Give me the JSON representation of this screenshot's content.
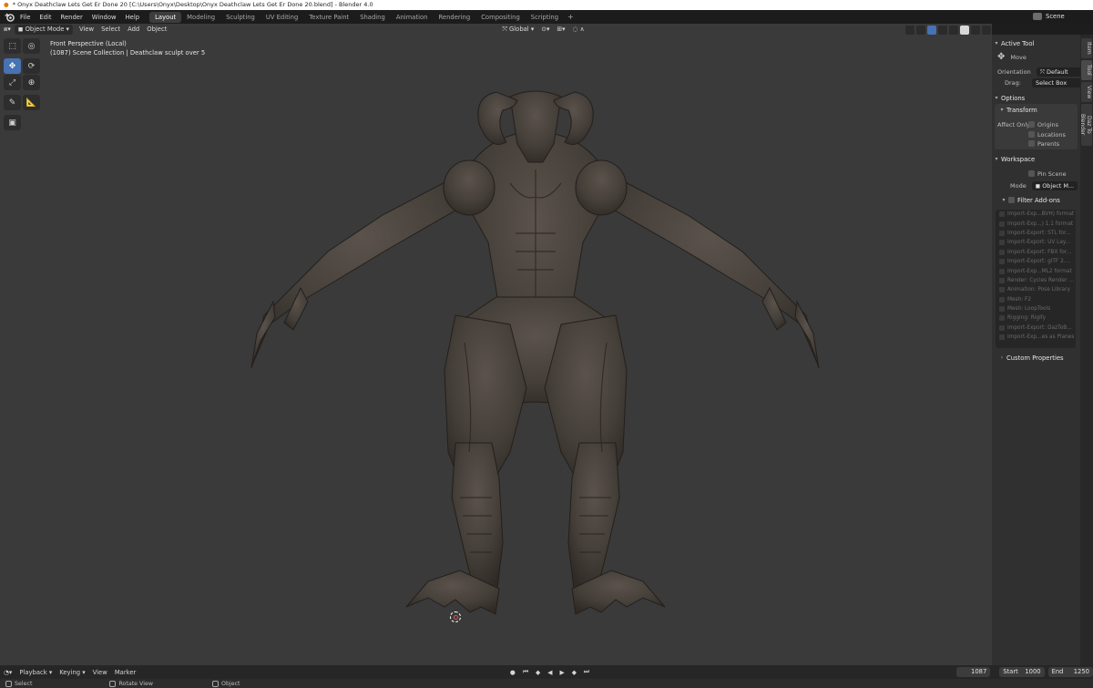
{
  "window": {
    "title": "* Onyx Deathclaw Lets Get Er Done 20 [C:\\Users\\Onyx\\Desktop\\Onyx Deathclaw Lets Get Er Done 20.blend] - Blender 4.0"
  },
  "menu": {
    "items": [
      "File",
      "Edit",
      "Render",
      "Window",
      "Help"
    ]
  },
  "workspaces": {
    "tabs": [
      "Layout",
      "Modeling",
      "Sculpting",
      "UV Editing",
      "Texture Paint",
      "Shading",
      "Animation",
      "Rendering",
      "Compositing",
      "Scripting"
    ],
    "active": "Layout"
  },
  "scene": {
    "name": "Scene"
  },
  "viewport": {
    "mode": "Object Mode",
    "menus": [
      "View",
      "Select",
      "Add",
      "Object"
    ],
    "transform_orientation": "Global",
    "perspective_label": "Front Perspective (Local)",
    "collection_label": "(1087) Scene Collection | Deathclaw sculpt over 5"
  },
  "sidebar": {
    "tabs": [
      "Item",
      "Tool",
      "View",
      "Daz To Blender"
    ],
    "active_tool": {
      "header": "Active Tool",
      "tool_name": "Move",
      "orientation_label": "Orientation",
      "orientation_value": "Default",
      "drag_label": "Drag:",
      "drag_value": "Select Box"
    },
    "options": {
      "header": "Options",
      "transform_header": "Transform",
      "affect_only_label": "Affect Only",
      "affect_only": [
        "Origins",
        "Locations",
        "Parents"
      ]
    },
    "workspace": {
      "header": "Workspace",
      "pin_scene": "Pin Scene",
      "mode_label": "Mode",
      "mode_value": "Object M...",
      "filter_addons": "Filter Add-ons",
      "addons": [
        "Import-Exp...BVH) format",
        "Import-Exp...) 1.1 format",
        "Import-Export: STL for...",
        "Import-Export: UV Lay...",
        "Import-Export: FBX for...",
        "Import-Export: glTF 2....",
        "Import-Exp...ML2 format",
        "Render: Cycles Render ...",
        "Animation: Pose Library",
        "Mesh: F2",
        "Mesh: LoopTools",
        "Rigging: Rigify",
        "Import-Export: DazToB...",
        "Import-Exp...es as Planes"
      ]
    },
    "custom_properties": "Custom Properties"
  },
  "timeline": {
    "menus": [
      "Playback",
      "Keying",
      "View",
      "Marker"
    ],
    "current_frame": "1087",
    "start_label": "Start",
    "start_value": "1000",
    "end_label": "End",
    "end_value": "1250"
  },
  "statusbar": {
    "items": [
      "Select",
      "Rotate View",
      "Object"
    ]
  }
}
